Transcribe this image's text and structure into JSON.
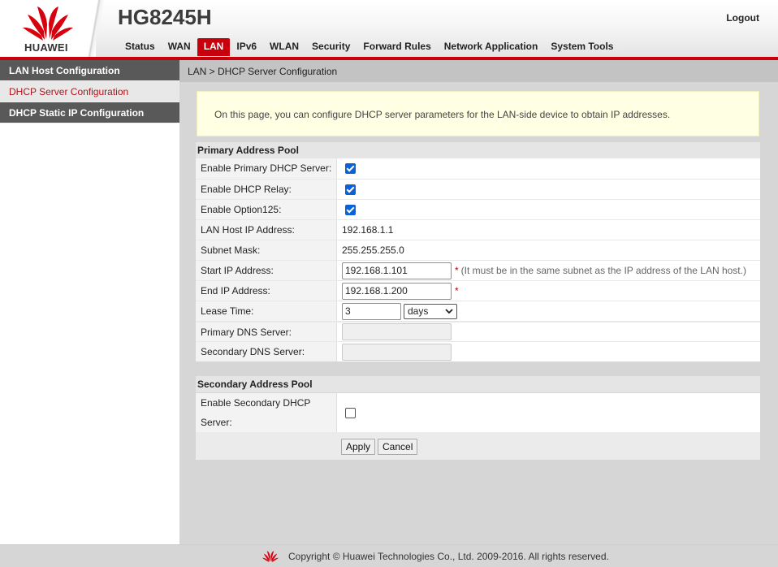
{
  "header": {
    "brand": "HUAWEI",
    "model": "HG8245H",
    "logout": "Logout",
    "brand_color": "#c7000b",
    "nav": [
      {
        "label": "Status",
        "active": false
      },
      {
        "label": "WAN",
        "active": false
      },
      {
        "label": "LAN",
        "active": true
      },
      {
        "label": "IPv6",
        "active": false
      },
      {
        "label": "WLAN",
        "active": false
      },
      {
        "label": "Security",
        "active": false
      },
      {
        "label": "Forward Rules",
        "active": false
      },
      {
        "label": "Network Application",
        "active": false
      },
      {
        "label": "System Tools",
        "active": false
      }
    ]
  },
  "sidebar": {
    "items": [
      {
        "label": "LAN Host Configuration",
        "state": "normal"
      },
      {
        "label": "DHCP Server Configuration",
        "state": "selected"
      },
      {
        "label": "DHCP Static IP Configuration",
        "state": "normal"
      }
    ]
  },
  "breadcrumb": "LAN > DHCP Server Configuration",
  "notice": "On this page, you can configure DHCP server parameters for the LAN-side device to obtain IP addresses.",
  "primary": {
    "title": "Primary Address Pool",
    "enable_dhcp_label": "Enable Primary DHCP Server:",
    "enable_dhcp": true,
    "enable_relay_label": "Enable DHCP Relay:",
    "enable_relay": true,
    "enable_option125_label": "Enable Option125:",
    "enable_option125": true,
    "lan_ip_label": "LAN Host IP Address:",
    "lan_ip": "192.168.1.1",
    "subnet_label": "Subnet Mask:",
    "subnet": "255.255.255.0",
    "start_ip_label": "Start IP Address:",
    "start_ip": "192.168.1.101",
    "start_ip_req": "*",
    "start_ip_hint": "(It must be in the same subnet as the IP address of the LAN host.)",
    "end_ip_label": "End IP Address:",
    "end_ip": "192.168.1.200",
    "end_ip_req": "*",
    "lease_label": "Lease Time:",
    "lease_value": "3",
    "lease_unit": "days",
    "primary_dns_label": "Primary DNS Server:",
    "primary_dns": "",
    "secondary_dns_label": "Secondary DNS Server:",
    "secondary_dns": ""
  },
  "secondary": {
    "title": "Secondary Address Pool",
    "enable_label": "Enable Secondary DHCP Server:",
    "enable": false
  },
  "buttons": {
    "apply": "Apply",
    "cancel": "Cancel"
  },
  "footer": {
    "copyright": "Copyright © Huawei Technologies Co., Ltd. 2009-2016. All rights reserved."
  }
}
